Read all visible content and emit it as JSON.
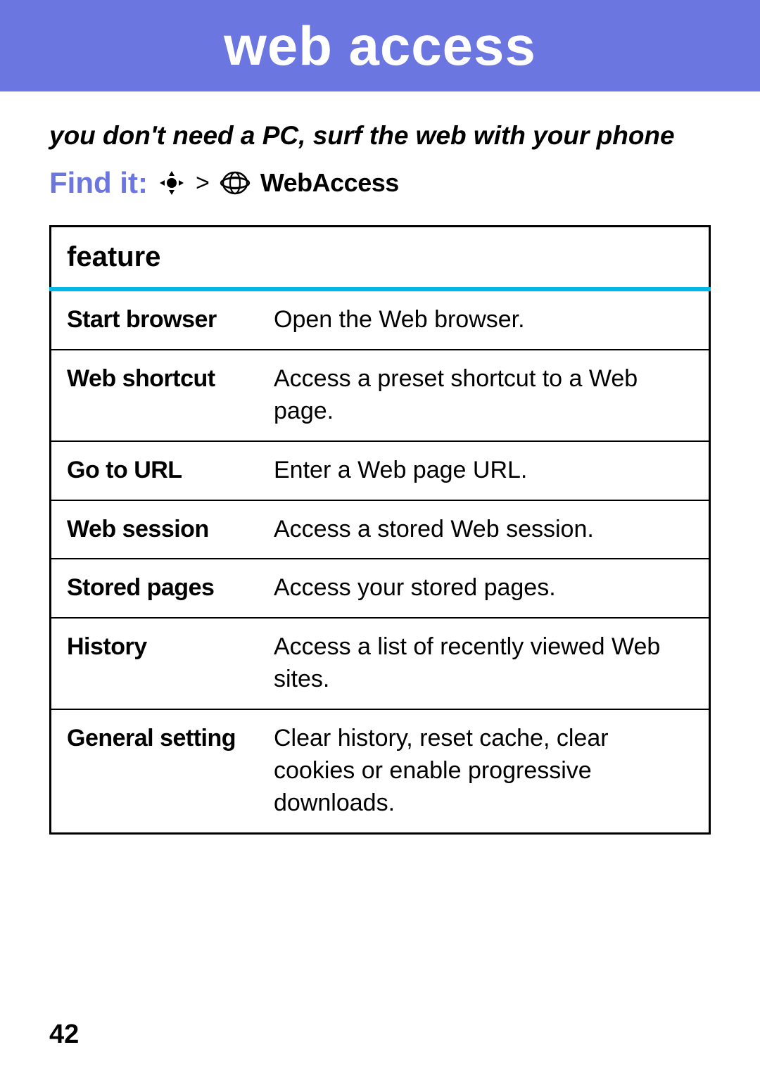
{
  "header": {
    "title": "web access"
  },
  "tagline": "you don't need a PC, surf the web with your phone",
  "find_it": {
    "label": "Find it:",
    "separator": ">",
    "target": "WebAccess"
  },
  "table": {
    "header": "feature",
    "rows": [
      {
        "name": "Start browser",
        "desc": "Open the Web browser."
      },
      {
        "name": "Web shortcut",
        "desc": "Access a preset shortcut to a Web page."
      },
      {
        "name": "Go to URL",
        "desc": "Enter a Web page URL."
      },
      {
        "name": "Web session",
        "desc": "Access a stored Web session."
      },
      {
        "name": "Stored pages",
        "desc": "Access your stored pages."
      },
      {
        "name": "History",
        "desc": "Access a list of recently viewed Web sites."
      },
      {
        "name": "General setting",
        "desc": "Clear history, reset cache, clear cookies or enable progressive downloads."
      }
    ]
  },
  "page_number": "42"
}
